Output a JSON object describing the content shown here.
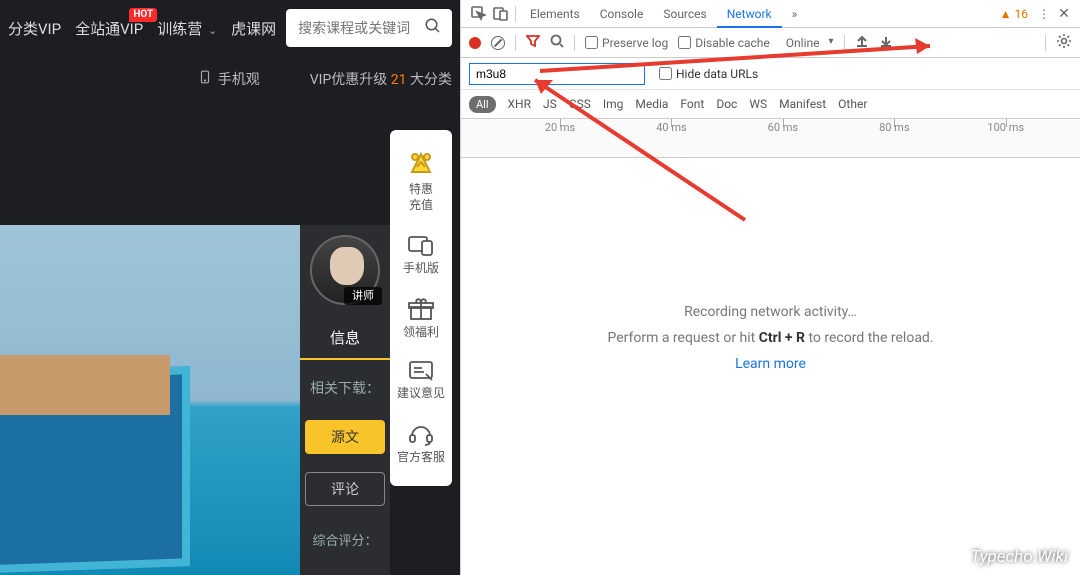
{
  "site": {
    "nav": [
      "分类VIP",
      "全站通VIP",
      "训练营",
      "虎课网"
    ],
    "hot": "HOT",
    "search_placeholder": "搜索课程或关键词",
    "promo_phone": "手机观",
    "promo_left": "VIP优惠升级 ",
    "promo_num": "21",
    "promo_right": "大分类",
    "rail": [
      {
        "t1": "特惠",
        "t2": "充值"
      },
      {
        "t1": "手机版"
      },
      {
        "t1": "领福利"
      },
      {
        "t1": "建议意见"
      },
      {
        "t1": "官方客服"
      }
    ],
    "avatar_tag": "讲师",
    "tab": "信息",
    "related": "相关下载：",
    "btn_src": "源文",
    "btn_review": "评论",
    "overall": "综合评分："
  },
  "dt": {
    "tabs": [
      "Elements",
      "Console",
      "Sources",
      "Network"
    ],
    "warn": "16",
    "toolbar": {
      "preserve": "Preserve log",
      "disable": "Disable cache",
      "online": "Online"
    },
    "filter_value": "m3u8",
    "hide_urls": "Hide data URLs",
    "types": [
      "All",
      "XHR",
      "JS",
      "CSS",
      "Img",
      "Media",
      "Font",
      "Doc",
      "WS",
      "Manifest",
      "Other"
    ],
    "timeline": [
      "20 ms",
      "40 ms",
      "60 ms",
      "80 ms",
      "100 ms"
    ],
    "msg1": "Recording network activity…",
    "msg2a": "Perform a request or hit ",
    "msg2b": "Ctrl + R",
    "msg2c": " to record the reload.",
    "learn": "Learn more"
  },
  "watermark": "Typecho.Wiki"
}
